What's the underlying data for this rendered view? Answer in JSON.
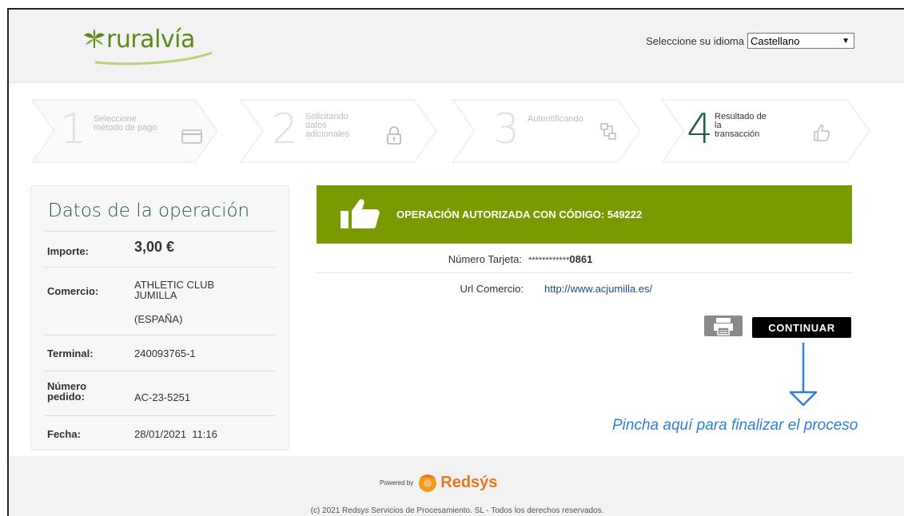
{
  "header": {
    "logo_text": "ruralvía",
    "language_label": "Seleccione su idioma",
    "language_selected": "Castellano"
  },
  "steps": [
    {
      "number": "1",
      "label_lines": [
        "Seleccione",
        "método de pago"
      ],
      "icon": "card-icon",
      "active": false
    },
    {
      "number": "2",
      "label_lines": [
        "Solicitando",
        "datos",
        "adicionales"
      ],
      "icon": "lock-icon",
      "active": false
    },
    {
      "number": "3",
      "label_lines": [
        "Autentificando"
      ],
      "icon": "network-icon",
      "active": false
    },
    {
      "number": "4",
      "label_lines": [
        "Resultado de",
        "la",
        "transacción"
      ],
      "icon": "thumbs-up-icon",
      "active": true
    }
  ],
  "operation": {
    "title": "Datos de la operación",
    "importe_label": "Importe:",
    "importe_value": "3,00 €",
    "comercio_label": "Comercio:",
    "comercio_line1": "ATHLETIC CLUB",
    "comercio_line2": "JUMILLA",
    "comercio_country": "(ESPAÑA)",
    "terminal_label": "Terminal:",
    "terminal_value": "240093765-1",
    "pedido_label_line1": "Número",
    "pedido_label_line2": "pedido:",
    "pedido_value": "AC-23-5251",
    "fecha_label": "Fecha:",
    "fecha_value": "28/01/2021  11:16"
  },
  "result": {
    "banner_text": "OPERACIÓN AUTORIZADA CON CÓDIGO: 549222",
    "card_label": "Número Tarjeta:",
    "card_mask": "************",
    "card_last": "0861",
    "url_label": "Url Comercio:",
    "url_value": "http://www.acjumilla.es/"
  },
  "actions": {
    "continue_label": "CONTINUAR",
    "hint": "Pincha aquí para finalizar el proceso"
  },
  "footer": {
    "powered_by": "Powered by",
    "brand": "Redsýs",
    "copyright": "(c) 2021 Redsys Servicios de Procesamiento. SL - Todos los derechos reservados."
  },
  "colors": {
    "brand_green": "#7a9a01",
    "title_green": "#1d5a4a",
    "hint_blue": "#2e7fd8",
    "redsys_orange": "#e87722"
  }
}
